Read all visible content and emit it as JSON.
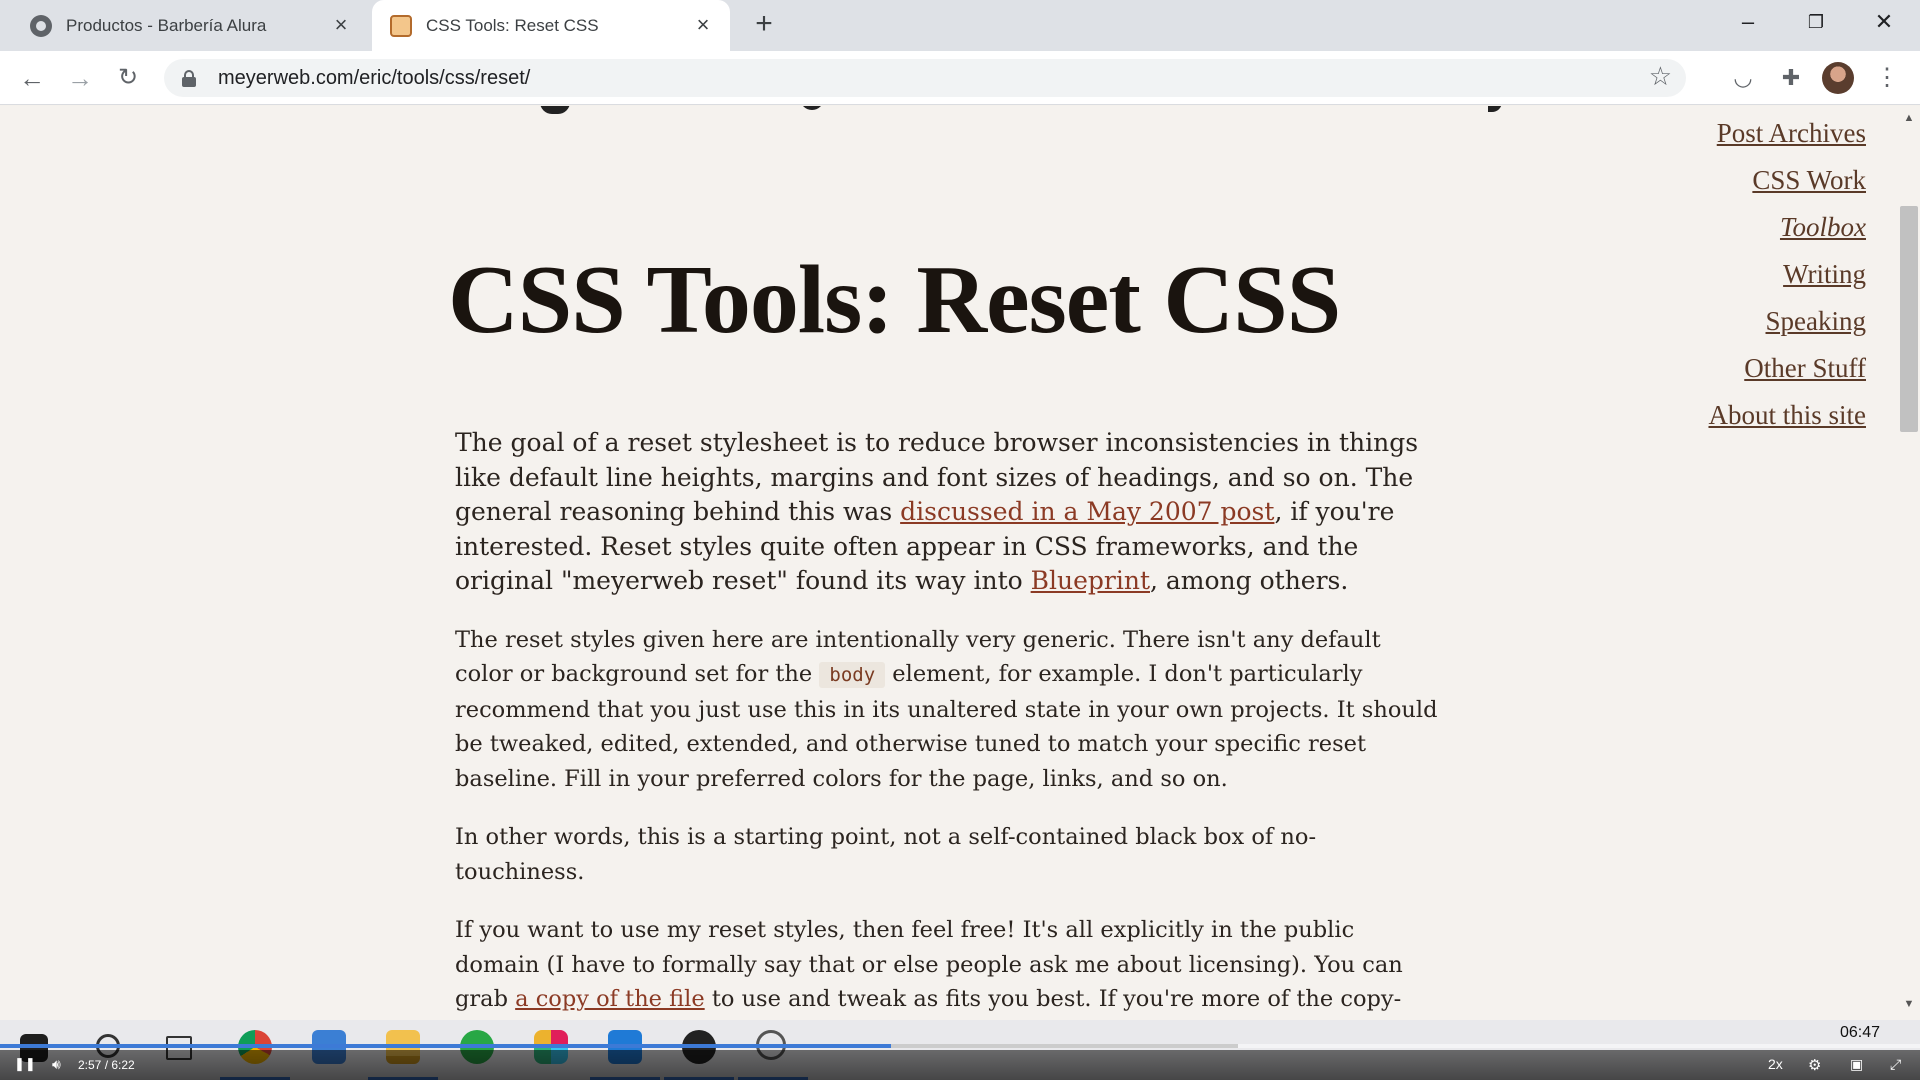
{
  "browser": {
    "tabs": [
      {
        "title": "Productos - Barbería Alura",
        "active": false
      },
      {
        "title": "CSS Tools: Reset CSS",
        "active": true
      }
    ],
    "new_tab": "+",
    "url": "meyerweb.com/eric/tools/css/reset/",
    "icons": {
      "back": "back-arrow-icon",
      "forward": "forward-arrow-icon",
      "reload": "reload-icon",
      "lock": "lock-icon",
      "bookmark": "star-icon",
      "pocket": "pocket-icon",
      "extensions": "puzzle-icon",
      "menu": "kebab-menu-icon"
    }
  },
  "page": {
    "title": "CSS Tools: Reset CSS",
    "nav": [
      "Post Archives",
      "CSS Work",
      "Toolbox",
      "Writing",
      "Speaking",
      "Other Stuff",
      "About this site"
    ],
    "current_nav": "Toolbox",
    "p1": {
      "a": "The goal of a reset stylesheet is to reduce browser inconsistencies in things like default line heights, margins and font sizes of headings, and so on. The general reasoning behind this was ",
      "link1": "discussed in a May 2007 post",
      "b": ", if you're interested. Reset styles quite often appear in CSS frameworks, and the original \"meyerweb reset\" found its way into ",
      "link2": "Blueprint",
      "c": ", among others."
    },
    "p2": {
      "a": "The reset styles given here are intentionally very generic. There isn't any default color or background set for the ",
      "code": "body",
      "b": " element, for example. I don't particularly recommend that you just use this in its unaltered state in your own projects. It should be tweaked, edited, extended, and otherwise tuned to match your specific reset baseline. Fill in your preferred colors for the page, links, and so on."
    },
    "p3": "In other words, this is a starting point, not a self-contained black box of no-touchiness.",
    "p4": {
      "a": "If you want to use my reset styles, then feel free! It's all explicitly in the public domain (I have to formally say that or else people ask me about licensing). You can grab ",
      "link": "a copy of the file",
      "b": " to use and tweak as fits you best. If you're more of the copy-and-paste type, or just want an in-page preview of what you'll be getting, here it is."
    }
  },
  "player": {
    "time": "2:57 / 6:22",
    "progress": 0.464,
    "buffered": 0.645,
    "speed": "2x",
    "clock": "06:47",
    "accent": "#3d7ad6"
  },
  "colors": {
    "link": "#8b3a24",
    "page_bg": "#f5f2ee",
    "tabstrip": "#dee1e6"
  }
}
